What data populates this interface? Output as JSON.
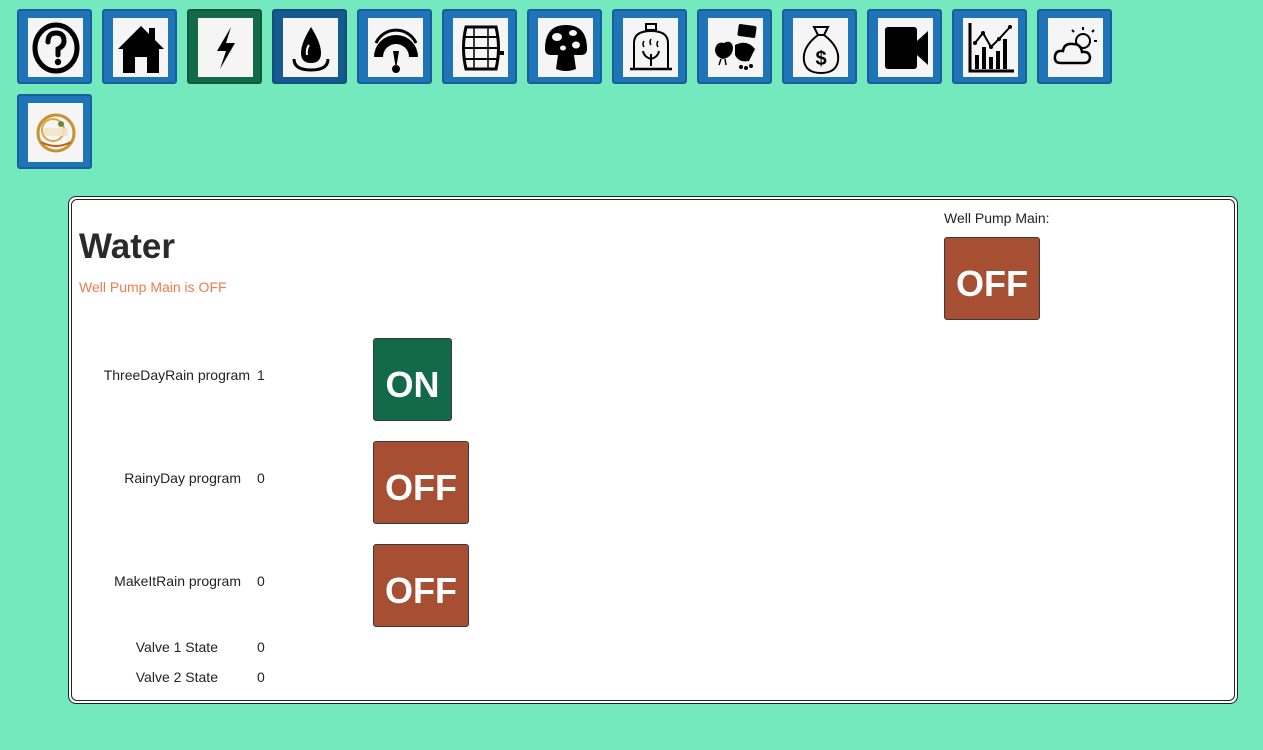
{
  "nav": [
    {
      "name": "help-icon",
      "state": "normal"
    },
    {
      "name": "home-icon",
      "state": "normal"
    },
    {
      "name": "lightning-icon",
      "state": "active-green"
    },
    {
      "name": "water-drop-icon",
      "state": "active-blue"
    },
    {
      "name": "gauge-icon",
      "state": "normal"
    },
    {
      "name": "barrel-icon",
      "state": "normal"
    },
    {
      "name": "mushroom-icon",
      "state": "normal"
    },
    {
      "name": "greenhouse-icon",
      "state": "normal"
    },
    {
      "name": "chicken-feed-icon",
      "state": "normal"
    },
    {
      "name": "money-bag-icon",
      "state": "normal"
    },
    {
      "name": "video-camera-icon",
      "state": "normal"
    },
    {
      "name": "chart-icon",
      "state": "normal"
    },
    {
      "name": "weather-icon",
      "state": "normal"
    },
    {
      "name": "logo-badge-icon",
      "state": "normal"
    }
  ],
  "panel": {
    "title": "Water",
    "status": "Well Pump Main is OFF",
    "pump_label": "Well Pump Main:",
    "pump_button": "OFF"
  },
  "rows": [
    {
      "label": "ThreeDayRain program",
      "value": "1",
      "button": "ON"
    },
    {
      "label": "RainyDay program",
      "value": "0",
      "button": "OFF"
    },
    {
      "label": "MakeItRain program",
      "value": "0",
      "button": "OFF"
    },
    {
      "label": "Valve 1 State",
      "value": "0"
    },
    {
      "label": "Valve 2 State",
      "value": "0"
    }
  ],
  "colors": {
    "background": "#74e9bd",
    "nav_button": "#1f73b7",
    "on_button": "#136a4b",
    "off_button": "#a74f32",
    "status_text": "#f07a4f"
  }
}
